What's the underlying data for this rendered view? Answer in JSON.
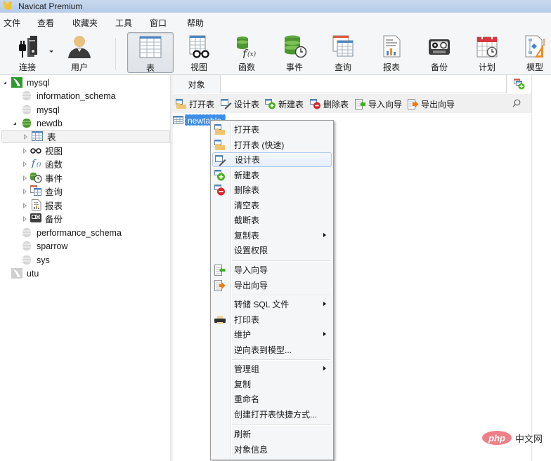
{
  "window": {
    "title": "Navicat Premium"
  },
  "menubar": {
    "items": [
      "文件",
      "查看",
      "收藏夹",
      "工具",
      "窗口",
      "帮助"
    ]
  },
  "toolbar": {
    "items": [
      {
        "id": "connect",
        "label": "连接",
        "icon": "plug-server-icon",
        "has_dropdown": true
      },
      {
        "id": "user",
        "label": "用户",
        "icon": "user-icon"
      },
      {
        "id": "table",
        "label": "表",
        "icon": "table-icon",
        "active": true
      },
      {
        "id": "view",
        "label": "视图",
        "icon": "view-glasses-icon"
      },
      {
        "id": "function",
        "label": "函数",
        "icon": "function-icon"
      },
      {
        "id": "event",
        "label": "事件",
        "icon": "event-clock-icon"
      },
      {
        "id": "query",
        "label": "查询",
        "icon": "query-icon"
      },
      {
        "id": "report",
        "label": "报表",
        "icon": "report-icon"
      },
      {
        "id": "backup",
        "label": "备份",
        "icon": "backup-tape-icon"
      },
      {
        "id": "schedule",
        "label": "计划",
        "icon": "calendar-icon"
      },
      {
        "id": "model",
        "label": "模型",
        "icon": "model-icon"
      }
    ]
  },
  "tree": {
    "connections": [
      {
        "label": "mysql",
        "expanded": true,
        "databases": [
          {
            "label": "information_schema",
            "active": false
          },
          {
            "label": "mysql",
            "active": false
          },
          {
            "label": "newdb",
            "active": true,
            "expanded": true,
            "children": [
              {
                "label": "表",
                "icon": "table-icon",
                "selected": true
              },
              {
                "label": "视图",
                "icon": "view-glasses-icon"
              },
              {
                "label": "函数",
                "icon": "function-icon"
              },
              {
                "label": "事件",
                "icon": "event-clock-icon"
              },
              {
                "label": "查询",
                "icon": "query-icon"
              },
              {
                "label": "报表",
                "icon": "report-icon"
              },
              {
                "label": "备份",
                "icon": "backup-tape-icon"
              }
            ]
          },
          {
            "label": "performance_schema",
            "active": false
          },
          {
            "label": "sparrow",
            "active": false
          },
          {
            "label": "sys",
            "active": false
          }
        ]
      },
      {
        "label": "utu",
        "expanded": false
      }
    ]
  },
  "tabs": {
    "objects_label": "对象"
  },
  "object_toolbar": {
    "open_table": "打开表",
    "design_table": "设计表",
    "new_table": "新建表",
    "delete_table": "删除表",
    "import_wizard": "导入向导",
    "export_wizard": "导出向导"
  },
  "objects": {
    "selected_item": "newtable"
  },
  "context_menu": {
    "items": [
      {
        "label": "打开表",
        "icon": "open-table-icon"
      },
      {
        "label": "打开表 (快速)",
        "icon": "open-table-fast-icon"
      },
      {
        "label": "设计表",
        "icon": "design-table-icon",
        "highlighted": true
      },
      {
        "label": "新建表",
        "icon": "new-table-icon"
      },
      {
        "label": "删除表",
        "icon": "delete-table-icon"
      },
      {
        "label": "清空表"
      },
      {
        "label": "截断表"
      },
      {
        "label": "复制表",
        "submenu": true
      },
      {
        "label": "设置权限"
      },
      {
        "label": "导入向导",
        "icon": "import-icon"
      },
      {
        "label": "导出向导",
        "icon": "export-icon"
      },
      {
        "label": "转储 SQL 文件",
        "submenu": true
      },
      {
        "label": "打印表",
        "icon": "printer-icon"
      },
      {
        "label": "维护",
        "submenu": true
      },
      {
        "label": "逆向表到模型..."
      },
      {
        "label": "管理组",
        "submenu": true
      },
      {
        "label": "复制"
      },
      {
        "label": "重命名"
      },
      {
        "label": "创建打开表快捷方式..."
      },
      {
        "label": "刷新"
      },
      {
        "label": "对象信息"
      }
    ]
  },
  "watermark": {
    "badge": "php",
    "text": "中文网"
  },
  "colors": {
    "accent": "#3d8ee6",
    "db_active": "#54a33a",
    "titlebar": "#c1d4ec"
  }
}
